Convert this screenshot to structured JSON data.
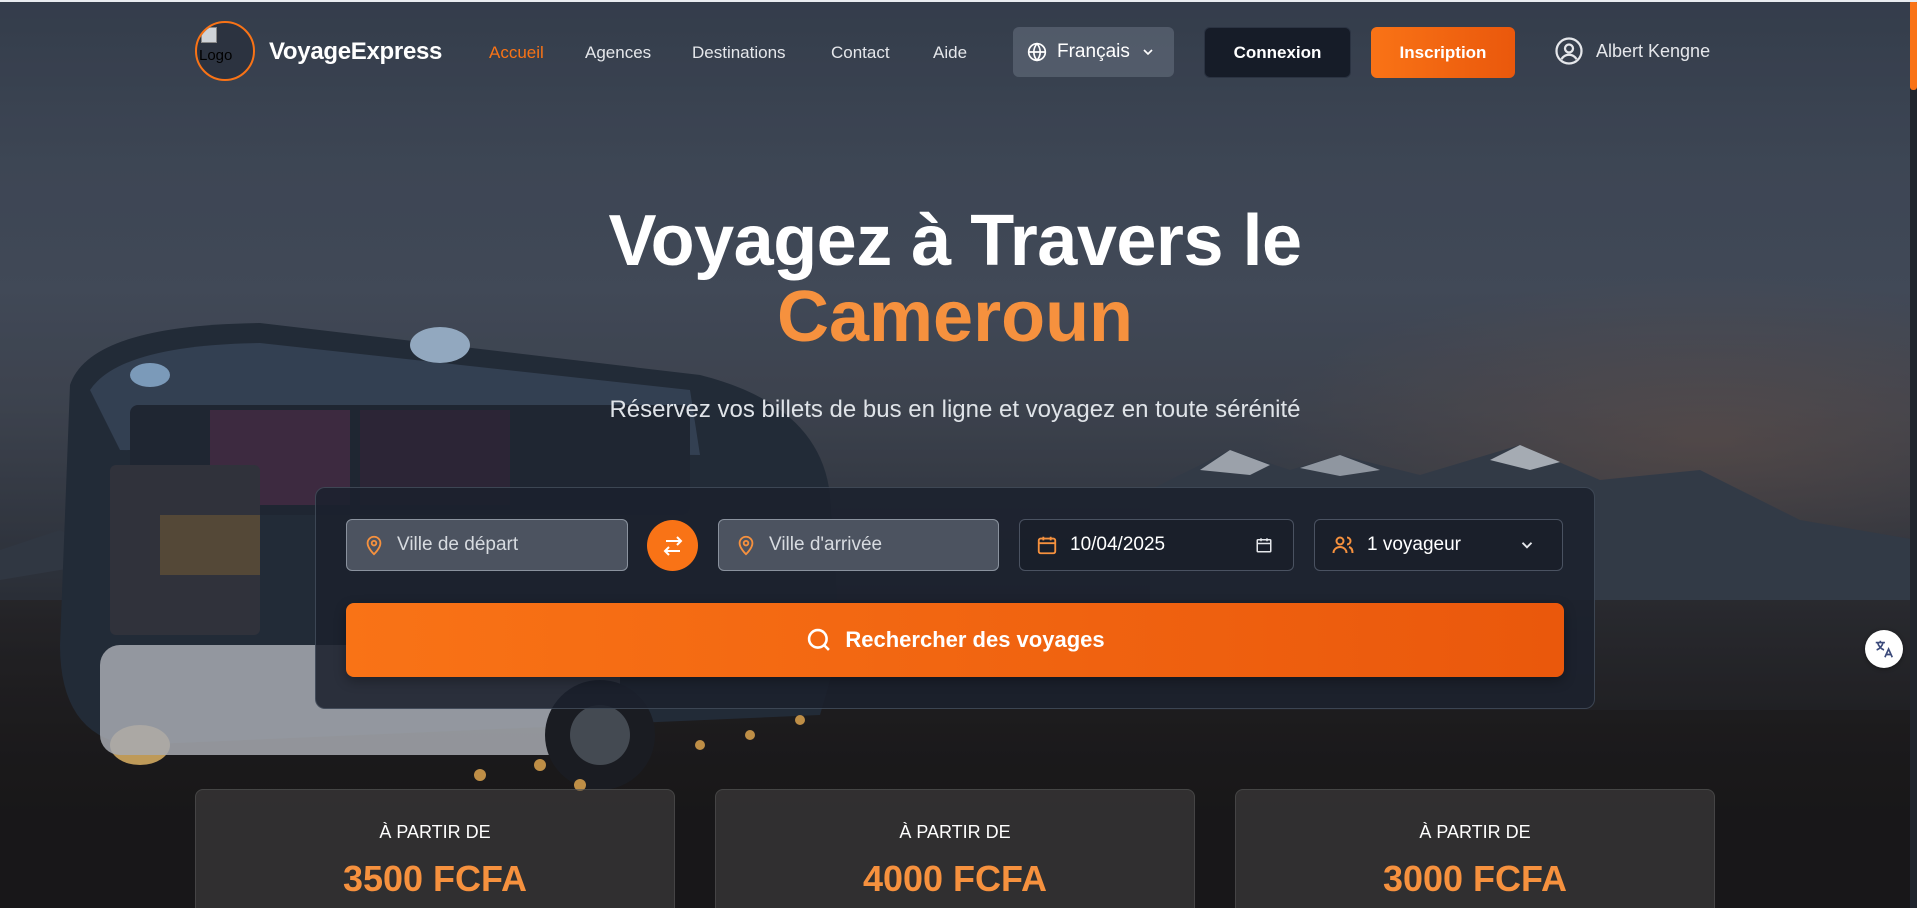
{
  "header": {
    "logo_alt": "Logo",
    "brand": "VoyageExpress",
    "nav": [
      {
        "label": "Accueil",
        "active": true
      },
      {
        "label": "Agences",
        "active": false
      },
      {
        "label": "Destinations",
        "active": false
      },
      {
        "label": "Contact",
        "active": false
      },
      {
        "label": "Aide",
        "active": false
      }
    ],
    "language": "Français",
    "login_label": "Connexion",
    "signup_label": "Inscription",
    "user_name": "Albert Kengne"
  },
  "hero": {
    "title_line1": "Voyagez à Travers le",
    "title_line2": "Cameroun",
    "subtitle": "Réservez vos billets de bus en ligne et voyagez en toute sérénité"
  },
  "search": {
    "departure_placeholder": "Ville de départ",
    "arrival_placeholder": "Ville d'arrivée",
    "date_value": "10/04/2025",
    "travelers_value": "1 voyageur",
    "search_label": "Rechercher des voyages"
  },
  "prices": [
    {
      "label": "À PARTIR DE",
      "price": "3500 FCFA"
    },
    {
      "label": "À PARTIR DE",
      "price": "4000 FCFA"
    },
    {
      "label": "À PARTIR DE",
      "price": "3000 FCFA"
    }
  ],
  "colors": {
    "accent": "#f97316",
    "accent_text": "#f6913e",
    "dark_button": "#161c28"
  },
  "icons": [
    "globe-icon",
    "chevron-down-icon",
    "user-circle-icon",
    "map-pin-icon",
    "swap-icon",
    "calendar-icon",
    "users-icon",
    "search-icon",
    "translate-icon"
  ]
}
